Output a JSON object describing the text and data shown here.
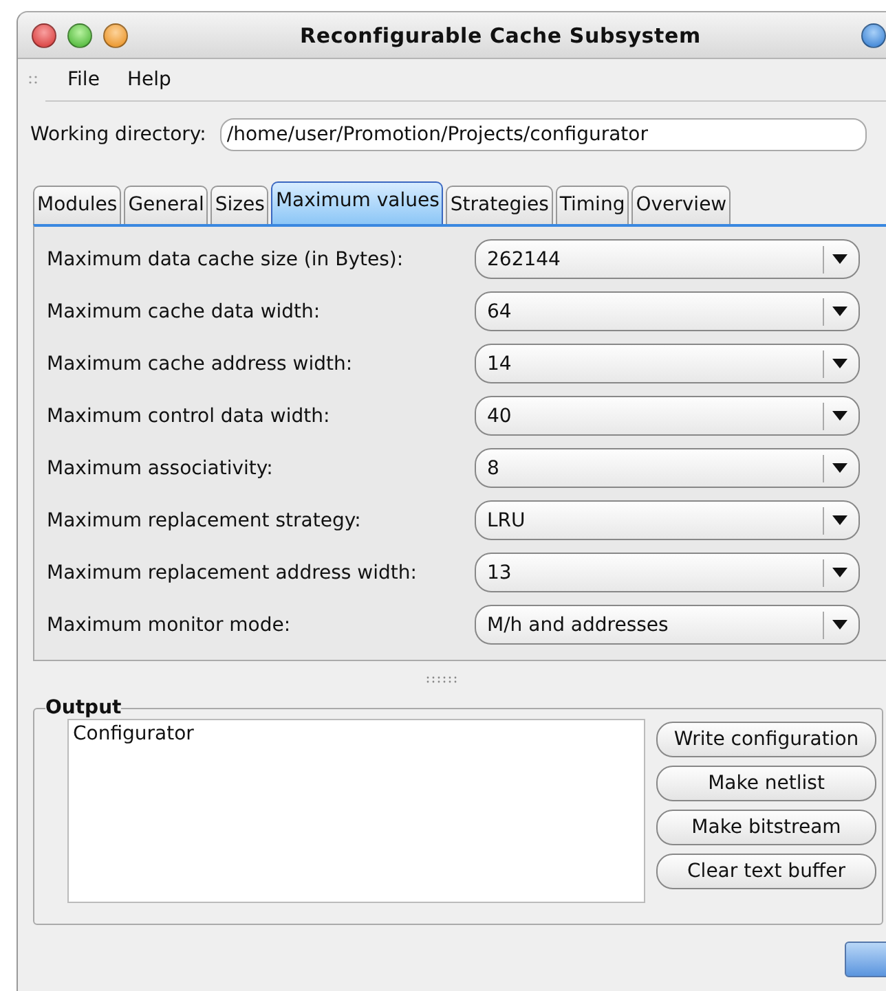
{
  "window": {
    "title": "Reconfigurable Cache Subsystem"
  },
  "menu": [
    "File",
    "Help"
  ],
  "working_directory": {
    "label": "Working directory:",
    "value": "/home/user/Promotion/Projects/configurator"
  },
  "tabs": [
    {
      "label": "Modules",
      "selected": false
    },
    {
      "label": "General",
      "selected": false
    },
    {
      "label": "Sizes",
      "selected": false
    },
    {
      "label": "Maximum values",
      "selected": true
    },
    {
      "label": "Strategies",
      "selected": false
    },
    {
      "label": "Timing",
      "selected": false
    },
    {
      "label": "Overview",
      "selected": false
    }
  ],
  "fields": [
    {
      "label": "Maximum data cache size (in Bytes):",
      "value": "262144"
    },
    {
      "label": "Maximum cache data width:",
      "value": "64"
    },
    {
      "label": "Maximum cache address width:",
      "value": "14"
    },
    {
      "label": "Maximum control data width:",
      "value": "40"
    },
    {
      "label": "Maximum associativity:",
      "value": "8"
    },
    {
      "label": "Maximum replacement strategy:",
      "value": "LRU"
    },
    {
      "label": "Maximum replacement address width:",
      "value": "13"
    },
    {
      "label": "Maximum monitor mode:",
      "value": "M/h and addresses"
    }
  ],
  "output": {
    "title": "Output",
    "text": "Configurator",
    "buttons": [
      "Write configuration",
      "Make netlist",
      "Make bitstream",
      "Clear text buffer"
    ]
  }
}
